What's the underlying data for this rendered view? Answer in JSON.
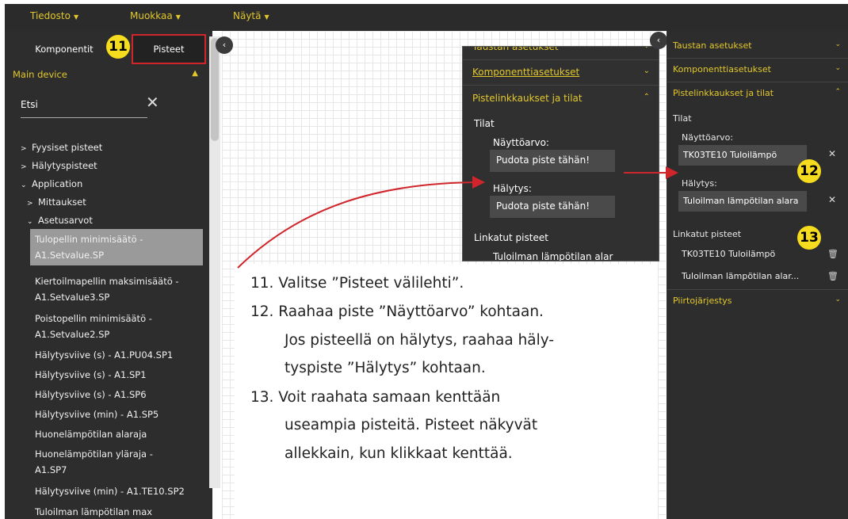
{
  "menu": [
    "Tiedosto",
    "Muokkaa",
    "Näytä"
  ],
  "tabs": {
    "components": "Komponentit",
    "points": "Pisteet"
  },
  "left": {
    "section": "Main device",
    "search_value": "Etsi",
    "tree": [
      "Fyysiset pisteet",
      "Hälytyspisteet",
      "Application",
      "Mittaukset",
      "Asetusarvot"
    ],
    "items": [
      "Tulopellin minimisäätö -",
      "A1.Setvalue.SP",
      "Kiertoilmapellin maksimisäätö -",
      "A1.Setvalue3.SP",
      "Poistopellin minimisäätö -",
      "A1.Setvalue2.SP",
      "Hälytysviive (s) - A1.PU04.SP1",
      "Hälytysviive (s) - A1.SP1",
      "Hälytysviive (s) - A1.SP6",
      "Hälytysviive (min) - A1.SP5",
      "Huonelämpötilan alaraja",
      "Huonelämpötilan yläraja -",
      "A1.SP7",
      "Hälytysviive (min) - A1.TE10.SP2",
      "Tuloilman lämpötilan max"
    ]
  },
  "zoom": {
    "h_background": "Taustan asetukset",
    "h_component": "Komponenttiasetukset",
    "h_links": "Pistelinkkaukset ja tilat",
    "states": "Tilat",
    "display_value": "Näyttöarvo:",
    "drop1": "Pudota piste tähän!",
    "alarm": "Hälytys:",
    "drop2": "Pudota piste tähän!",
    "linked": "Linkatut pisteet",
    "linked_item": "Tuloilman lämpötilan alar"
  },
  "instructions": [
    "11.  Valitse ”Pisteet välilehti”.",
    "12.  Raahaa piste ”Näyttöarvo” kohtaan.",
    "Jos pisteellä on hälytys, raahaa häly-",
    "tyspiste ”Hälytys” kohtaan.",
    "13.  Voit raahata samaan kenttään",
    "useampia pisteitä. Pisteet näkyvät",
    "allekkain, kun klikkaat kenttää."
  ],
  "right": {
    "h_background": "Taustan asetukset",
    "h_component": "Komponenttiasetukset",
    "h_links": "Pistelinkkaukset ja tilat",
    "states": "Tilat",
    "display_value": "Näyttöarvo:",
    "display_field": "TK03TE10 Tuloilämpö",
    "alarm": "Hälytys:",
    "alarm_field": "Tuloilman lämpötilan alara",
    "linked": "Linkatut pisteet",
    "linked_items": [
      "TK03TE10 Tuloilämpö",
      "Tuloilman lämpötilan alar..."
    ],
    "drawing_order": "Piirtojärjestys"
  },
  "badges": [
    "11",
    "12",
    "13"
  ],
  "colors": {
    "accent": "#e2c82c",
    "badge": "#f5dc1e",
    "arrow": "#d0262b",
    "panel": "#2d2d2d"
  }
}
